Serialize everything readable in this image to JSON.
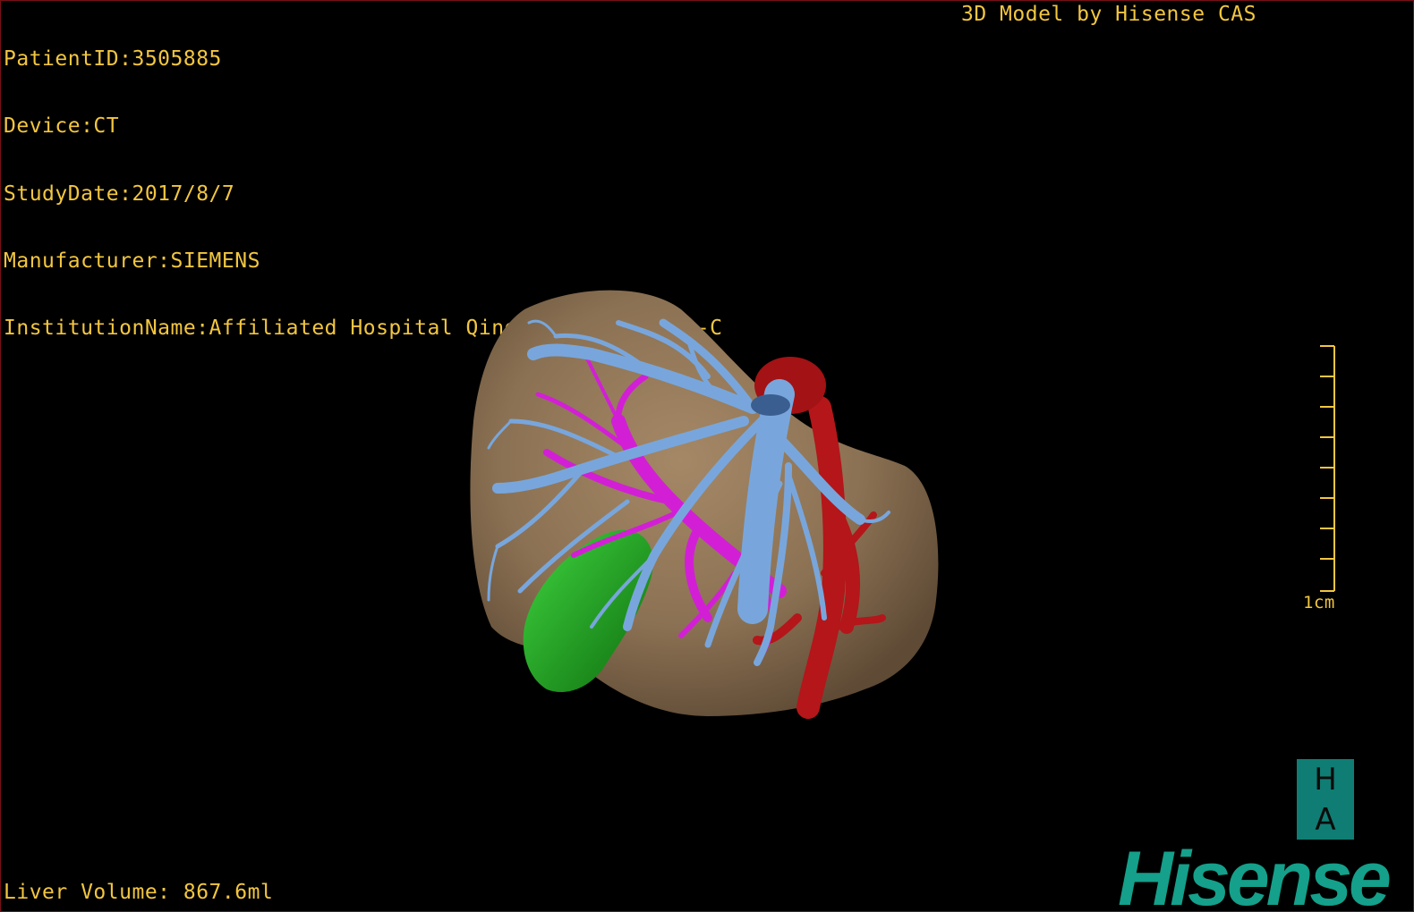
{
  "header": {
    "patient_id": "PatientID:3505885",
    "device": "Device:CT",
    "study_date": "StudyDate:2017/8/7",
    "manufacturer": "Manufacturer:SIEMENS",
    "institution": "InstitutionName:Affiliated Hospital Qingdao University-C"
  },
  "credit": "3D Model by Hisense CAS",
  "scale_bar": {
    "label": "1cm"
  },
  "footer": {
    "liver_volume": "Liver Volume: 867.6ml"
  },
  "logo": {
    "ha_top": "H",
    "ha_bottom": "A",
    "brand": "Hisense"
  },
  "colors": {
    "text": "#f2c640",
    "liver": "#8b7153",
    "hepatic_vein": "#78a6dc",
    "portal_vein": "#d21fd6",
    "artery": "#b4161a",
    "gallbladder": "#1c9a1c",
    "brand": "#14a08a"
  }
}
